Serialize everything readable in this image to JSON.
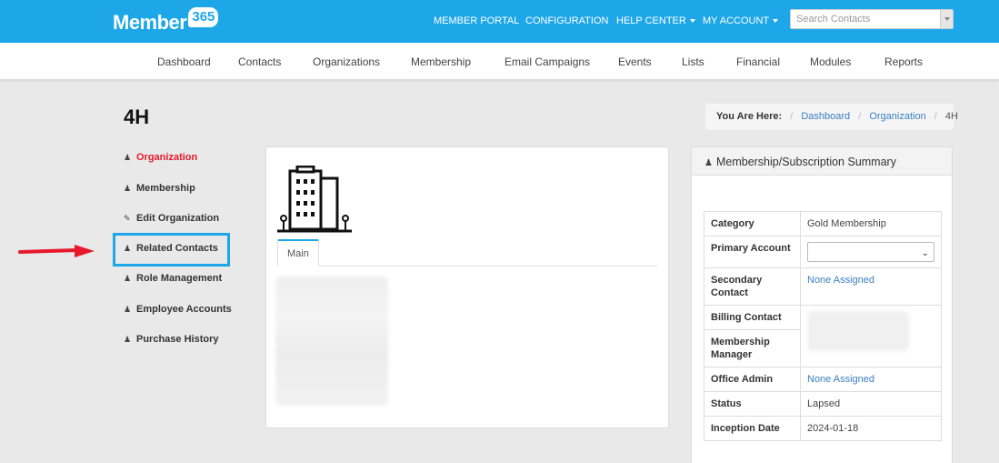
{
  "brand": {
    "name": "Member",
    "badge": "365"
  },
  "topnav": [
    {
      "label": "MEMBER PORTAL",
      "dropdown": false
    },
    {
      "label": "CONFIGURATION",
      "dropdown": false
    },
    {
      "label": "HELP CENTER",
      "dropdown": true
    },
    {
      "label": "MY ACCOUNT",
      "dropdown": true
    }
  ],
  "search": {
    "placeholder": "Search Contacts"
  },
  "mainnav": [
    "Dashboard",
    "Contacts",
    "Organizations",
    "Membership",
    "Email Campaigns",
    "Events",
    "Lists",
    "Financial",
    "Modules",
    "Reports"
  ],
  "page": {
    "title": "4H"
  },
  "breadcrumb": {
    "label": "You Are Here:",
    "items": [
      "Dashboard",
      "Organization"
    ],
    "current": "4H"
  },
  "sidemenu": [
    {
      "label": "Organization",
      "icon": "user-icon",
      "active": true
    },
    {
      "label": "Membership",
      "icon": "user-icon",
      "active": false
    },
    {
      "label": "Edit Organization",
      "icon": "edit-icon",
      "active": false
    },
    {
      "label": "Related Contacts",
      "icon": "user-icon",
      "active": false
    },
    {
      "label": "Role Management",
      "icon": "user-icon",
      "active": false
    },
    {
      "label": "Employee Accounts",
      "icon": "user-icon",
      "active": false
    },
    {
      "label": "Purchase History",
      "icon": "user-icon",
      "active": false
    }
  ],
  "center": {
    "tab": "Main",
    "icon": "building-icon"
  },
  "summary": {
    "title": "Membership/Subscription Summary",
    "rows": [
      {
        "key": "Category",
        "value": "Gold Membership"
      },
      {
        "key": "Primary Account",
        "value": ""
      },
      {
        "key": "Secondary Contact",
        "value": "None Assigned"
      },
      {
        "key": "Billing Contact",
        "value": ""
      },
      {
        "key": "Membership Manager",
        "value": ""
      },
      {
        "key": "Office Admin",
        "value": "None Assigned"
      },
      {
        "key": "Status",
        "value": "Lapsed"
      },
      {
        "key": "Inception Date",
        "value": "2024-01-18"
      }
    ]
  },
  "colors": {
    "accent": "#1ea7e8",
    "active": "#e8192c",
    "link": "#3b7fc4",
    "arrow": "#e8192c"
  }
}
